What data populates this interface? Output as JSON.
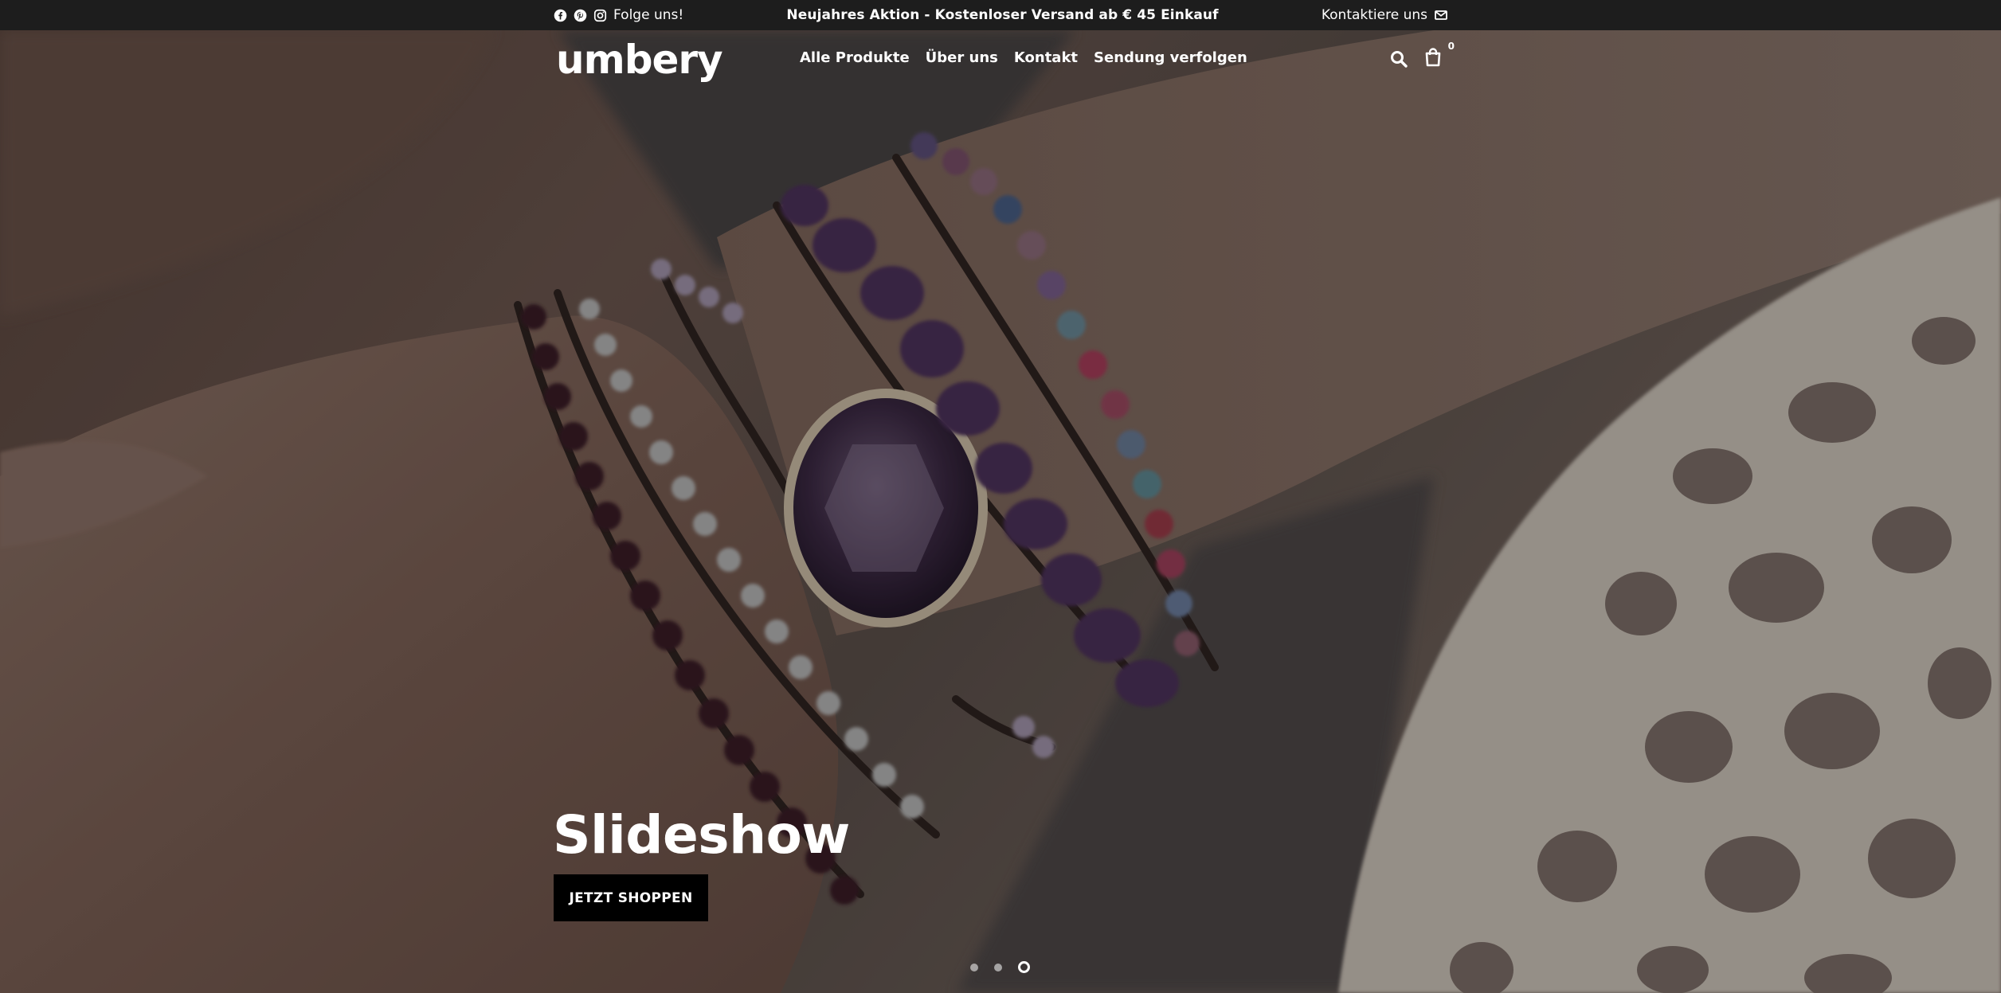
{
  "topbar": {
    "follow_label": "Folge uns!",
    "promo_text": "Neujahres Aktion - Kostenloser Versand ab € 45 Einkauf",
    "contact_label": "Kontaktiere uns",
    "social_icons": [
      "facebook-icon",
      "pinterest-icon",
      "instagram-icon"
    ]
  },
  "header": {
    "logo": "umbery",
    "nav": [
      {
        "label": "Alle Produkte"
      },
      {
        "label": "Über uns"
      },
      {
        "label": "Kontakt"
      },
      {
        "label": "Sendung verfolgen"
      }
    ],
    "cart_count": "0"
  },
  "hero": {
    "title": "Slideshow",
    "cta_label": "JETZT SHOPPEN",
    "slides_total": 3,
    "active_slide": 3
  },
  "colors": {
    "topbar_bg": "#1d1d1d",
    "button_bg": "#000000",
    "text": "#ffffff"
  }
}
